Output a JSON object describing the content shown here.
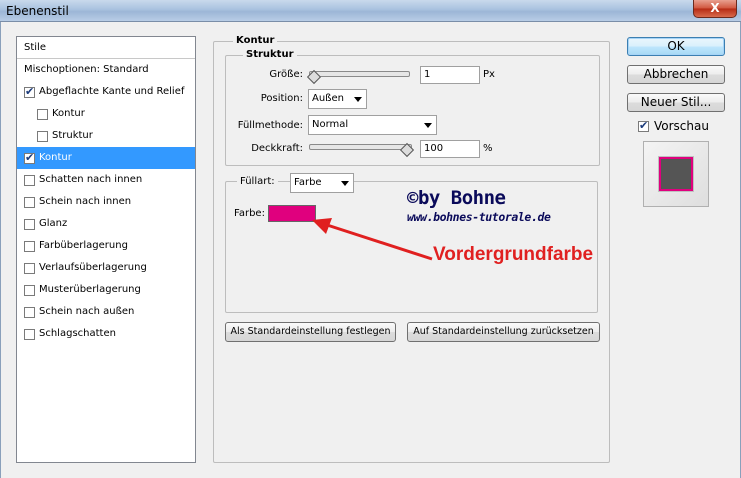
{
  "window": {
    "title": "Ebenenstil",
    "close_label": "X"
  },
  "sidebar": {
    "header": "Stile",
    "items": [
      {
        "label": "Mischoptionen: Standard",
        "checkbox": false,
        "checked": false,
        "indent": 0,
        "selected": false
      },
      {
        "label": "Abgeflachte Kante und Relief",
        "checkbox": true,
        "checked": true,
        "indent": 0,
        "selected": false
      },
      {
        "label": "Kontur",
        "checkbox": true,
        "checked": false,
        "indent": 1,
        "selected": false
      },
      {
        "label": "Struktur",
        "checkbox": true,
        "checked": false,
        "indent": 1,
        "selected": false
      },
      {
        "label": "Kontur",
        "checkbox": true,
        "checked": true,
        "indent": 0,
        "selected": true
      },
      {
        "label": "Schatten nach innen",
        "checkbox": true,
        "checked": false,
        "indent": 0,
        "selected": false
      },
      {
        "label": "Schein nach innen",
        "checkbox": true,
        "checked": false,
        "indent": 0,
        "selected": false
      },
      {
        "label": "Glanz",
        "checkbox": true,
        "checked": false,
        "indent": 0,
        "selected": false
      },
      {
        "label": "Farbüberlagerung",
        "checkbox": true,
        "checked": false,
        "indent": 0,
        "selected": false
      },
      {
        "label": "Verlaufsüberlagerung",
        "checkbox": true,
        "checked": false,
        "indent": 0,
        "selected": false
      },
      {
        "label": "Musterüberlagerung",
        "checkbox": true,
        "checked": false,
        "indent": 0,
        "selected": false
      },
      {
        "label": "Schein nach außen",
        "checkbox": true,
        "checked": false,
        "indent": 0,
        "selected": false
      },
      {
        "label": "Schlagschatten",
        "checkbox": true,
        "checked": false,
        "indent": 0,
        "selected": false
      }
    ]
  },
  "kontur": {
    "title": "Kontur",
    "struktur_title": "Struktur",
    "size": {
      "label": "Größe:",
      "value": "1",
      "unit": "Px",
      "slider_fraction": 0.0
    },
    "position": {
      "label": "Position:",
      "value": "Außen"
    },
    "blend": {
      "label": "Füllmethode:",
      "value": "Normal"
    },
    "opacity": {
      "label": "Deckkraft:",
      "value": "100",
      "unit": "%",
      "slider_fraction": 1.0
    },
    "fill": {
      "label": "Füllart:",
      "value": "Farbe"
    },
    "color": {
      "label": "Farbe:",
      "hex": "#e0007e"
    },
    "default_button": "Als Standardeinstellung festlegen",
    "reset_button": "Auf Standardeinstellung zurücksetzen"
  },
  "buttons": {
    "ok": "OK",
    "cancel": "Abbrechen",
    "new_style": "Neuer Stil...",
    "preview_label": "Vorschau",
    "preview_checked": true
  },
  "overlay": {
    "watermark": "©by Bohne",
    "website": "www.bohnes-tutorale.de",
    "annotation": "Vordergrundfarbe",
    "annotation_color": "#e02020"
  },
  "colors": {
    "selection": "#3399ff",
    "stroke_color": "#e0007e"
  }
}
